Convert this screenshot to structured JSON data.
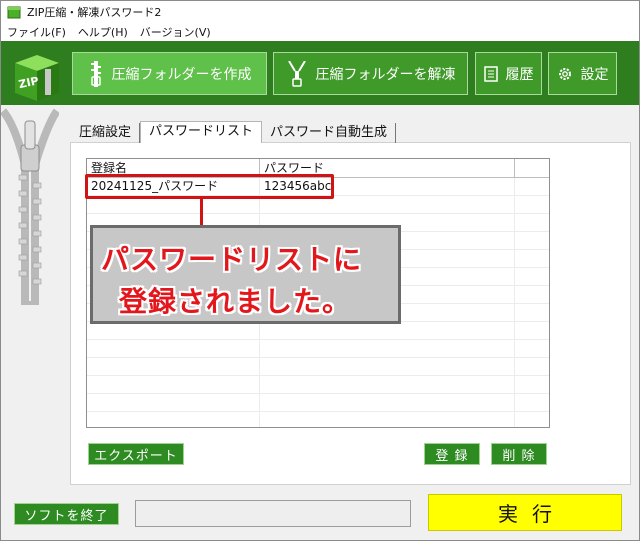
{
  "window": {
    "title": "ZIP圧縮・解凍パスワード2"
  },
  "menu": [
    {
      "label": "ファイル(F)"
    },
    {
      "label": "ヘルプ(H)"
    },
    {
      "label": "バージョン(V)"
    }
  ],
  "toolbar": {
    "logo_text": "ZIP",
    "compress_label": "圧縮フォルダーを作成",
    "extract_label": "圧縮フォルダーを解凍",
    "history_label": "履歴",
    "settings_label": "設定"
  },
  "tabs": [
    {
      "label": "圧縮設定"
    },
    {
      "label": "パスワードリスト"
    },
    {
      "label": "パスワード自動生成"
    }
  ],
  "password_list": {
    "columns": [
      "登録名",
      "パスワード",
      ""
    ],
    "rows": [
      {
        "name": "20241125_パスワード",
        "password": "123456abc"
      }
    ]
  },
  "callout": {
    "line1": "パスワードリストに",
    "line2": "登録されました。"
  },
  "buttons": {
    "export_label": "エクスポート",
    "register_label": "登 録",
    "delete_label": "削 除",
    "quit_label": "ソフトを終了",
    "execute_label": "実行"
  },
  "colors": {
    "toolbar_bg": "#2e7d1f",
    "button_green": "#2e8b22",
    "active_button": "#5fc04a",
    "highlight_red": "#d21313",
    "execute_yellow": "#ffff00"
  }
}
